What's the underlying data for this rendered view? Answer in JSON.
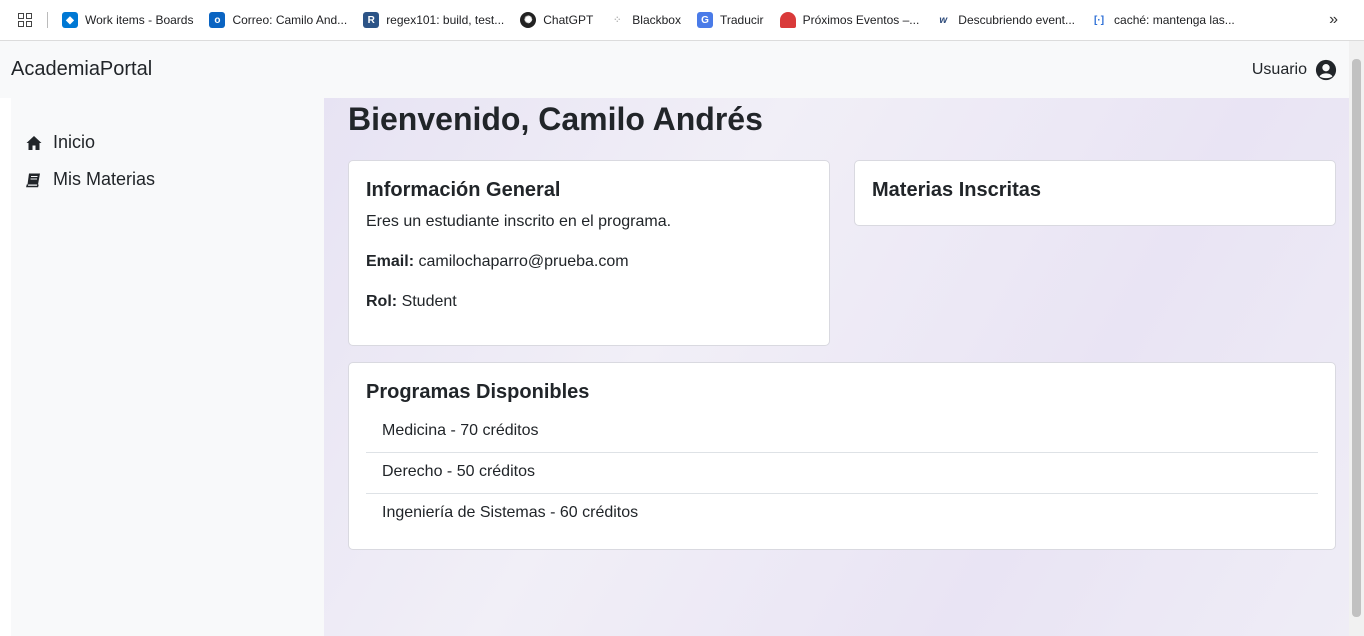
{
  "bookmarks": [
    {
      "label": "Work items - Boards",
      "icon": "azure-boards-icon",
      "color": "#0078d4"
    },
    {
      "label": "Correo: Camilo And...",
      "icon": "outlook-icon",
      "color": "#0a64c2"
    },
    {
      "label": "regex101: build, test...",
      "icon": "regex101-icon",
      "color": "#2c5487"
    },
    {
      "label": "ChatGPT",
      "icon": "chatgpt-icon",
      "color": "#222222"
    },
    {
      "label": "Blackbox",
      "icon": "blackbox-icon",
      "color": "#cccccc"
    },
    {
      "label": "Traducir",
      "icon": "translate-icon",
      "color": "#4a7be8"
    },
    {
      "label": "Próximos Eventos –...",
      "icon": "watermelon-icon",
      "color": "#d93a3a"
    },
    {
      "label": "Descubriendo event...",
      "icon": "w-icon",
      "color": "#2d4a7a"
    },
    {
      "label": "caché: mantenga las...",
      "icon": "bracket-icon",
      "color": "#2d6fd6"
    }
  ],
  "more_glyph": "»",
  "header": {
    "brand": "AcademiaPortal",
    "user_label": "Usuario"
  },
  "sidebar": {
    "items": [
      {
        "label": "Inicio",
        "icon": "home-icon"
      },
      {
        "label": "Mis Materias",
        "icon": "book-icon"
      }
    ]
  },
  "main": {
    "welcome": "Bienvenido, Camilo Andrés",
    "info": {
      "title": "Información General",
      "description": "Eres un estudiante inscrito en el programa.",
      "email_label": "Email:",
      "email_value": "camilochaparro@prueba.com",
      "role_label": "Rol:",
      "role_value": "Student"
    },
    "enrolled": {
      "title": "Materias Inscritas"
    },
    "programs": {
      "title": "Programas Disponibles",
      "items": [
        "Medicina - 70 créditos",
        "Derecho - 50 créditos",
        "Ingeniería de Sistemas - 60 créditos"
      ]
    }
  }
}
